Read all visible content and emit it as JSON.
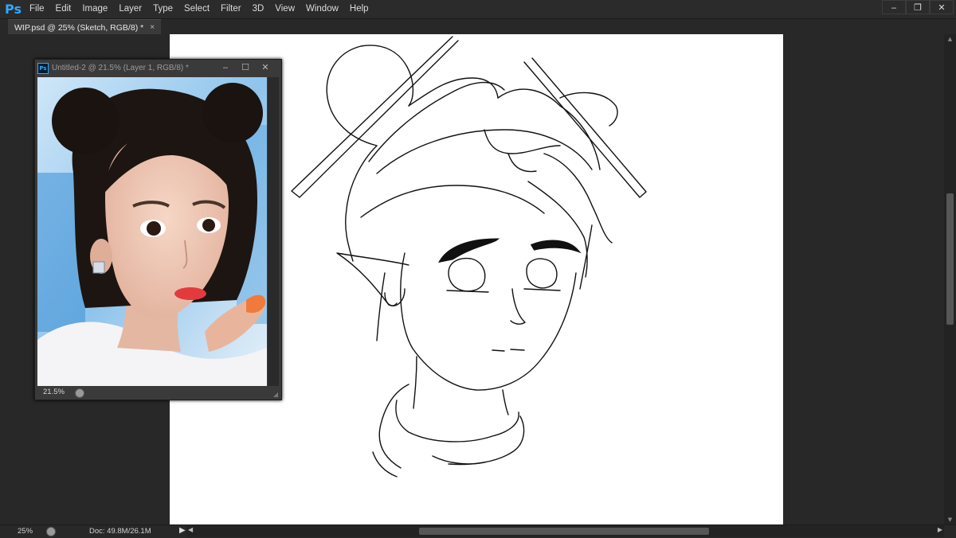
{
  "app": {
    "logo": "Ps",
    "accent": "#31a8ff"
  },
  "menu": [
    "File",
    "Edit",
    "Image",
    "Layer",
    "Type",
    "Select",
    "Filter",
    "3D",
    "View",
    "Window",
    "Help"
  ],
  "window_controls": {
    "minimize": "‒",
    "restore": "❐",
    "close": "✕"
  },
  "document_tab": {
    "title": "WIP.psd @ 25% (Sketch, RGB/8) *",
    "close": "×"
  },
  "floating_window": {
    "icon": "Ps",
    "title": "Untitled-2 @ 21.5% (Layer 1, RGB/8) *",
    "minimize": "‒",
    "maximize": "☐",
    "close": "✕",
    "zoom": "21.5%",
    "photo_icon": "reference-photo"
  },
  "status": {
    "zoom": "25%",
    "doc": "Doc: 49.8M/26.1M",
    "arrow": "▶"
  },
  "colors": {
    "canvas": "#ffffff",
    "workspace": "#282828",
    "ink": "#111111"
  }
}
